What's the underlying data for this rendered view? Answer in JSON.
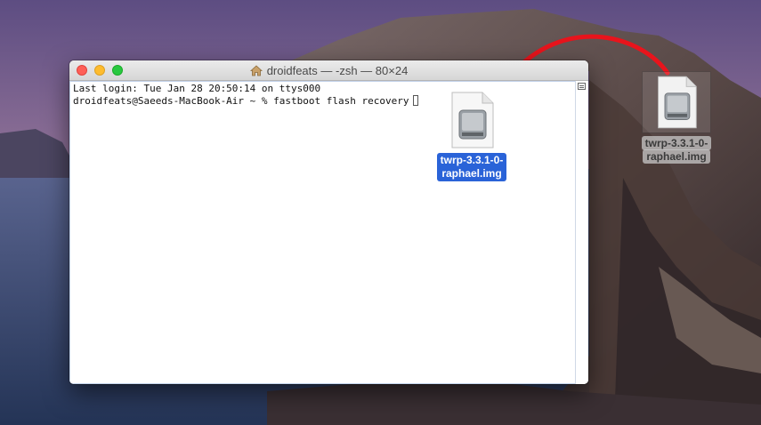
{
  "window": {
    "title": "droidfeats — -zsh — 80×24"
  },
  "terminal": {
    "line1": "Last login: Tue Jan 28 20:50:14 on ttys000",
    "line2": "droidfeats@Saeeds-MacBook-Air ~ % fastboot flash recovery"
  },
  "files": {
    "dragging": {
      "label_line1": "twrp-3.3.1-0-",
      "label_line2": "raphael.img"
    },
    "desktop": {
      "label_line1": "twrp-3.3.1-0-",
      "label_line2": "raphael.img"
    }
  },
  "colors": {
    "selection_blue": "#2a63d8",
    "arrow_red": "#e8141c"
  }
}
